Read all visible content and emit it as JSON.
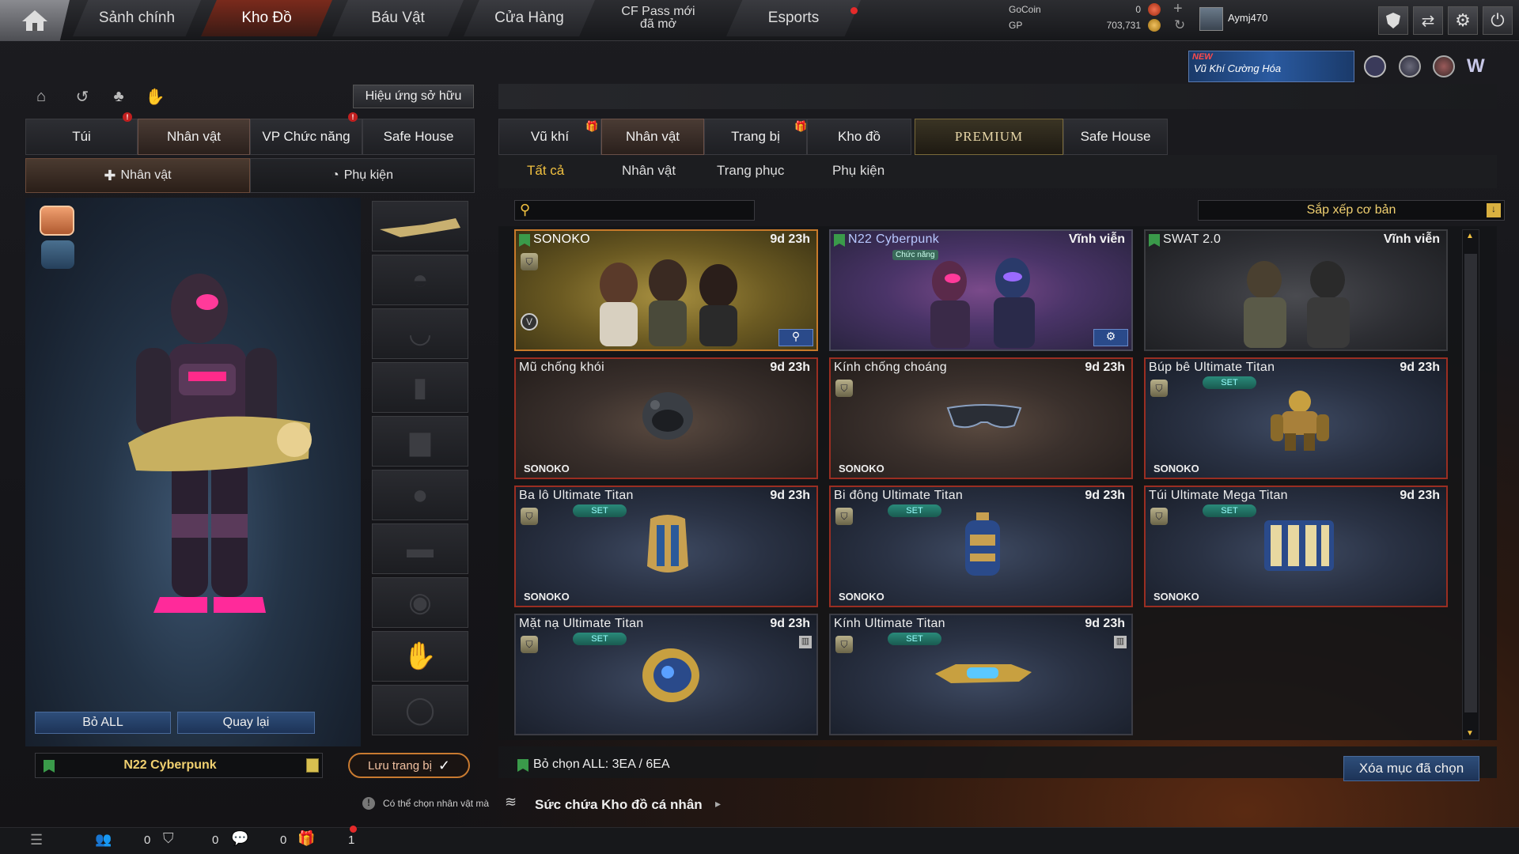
{
  "topbar": {
    "tabs": [
      "Sảnh chính",
      "Kho Đồ",
      "Báu Vật",
      "Cửa Hàng",
      "Esports"
    ],
    "pass_line1": "CF Pass mới",
    "pass_line2": "đã mở",
    "gocoin_label": "GoCoin",
    "gocoin_value": "0",
    "gp_label": "GP",
    "gp_value": "703,731",
    "username": "Aymj470",
    "banner_new": "NEW",
    "banner_text": "Vũ Khí Cường Hóa"
  },
  "left": {
    "owned_effects_btn": "Hiệu ứng sở hữu",
    "tabs": [
      "Túi",
      "Nhân vật",
      "VP Chức năng",
      "Safe House"
    ],
    "subtabs": [
      "Nhân vật",
      "Phụ kiện"
    ],
    "remove_all": "Bỏ ALL",
    "back": "Quay lại",
    "preset_name": "N22 Cyberpunk",
    "save_equip": "Lưu trang bị",
    "note": "Có thể chọn nhân vật mà"
  },
  "right": {
    "tabs": [
      "Vũ khí",
      "Nhân vật",
      "Trang bị",
      "Kho đồ",
      "PREMIUM",
      "Safe House"
    ],
    "filters": [
      "Tất cả",
      "Nhân vật",
      "Trang phục",
      "Phụ kiện"
    ],
    "search_placeholder": "",
    "sort_label": "Sắp xếp cơ bản",
    "items": [
      {
        "name": "SONOKO",
        "time": "9d 23h",
        "owner": "",
        "set": ""
      },
      {
        "name": "N22 Cyberpunk",
        "time": "Vĩnh viễn",
        "owner": "",
        "set": "",
        "tag": "Chức năng"
      },
      {
        "name": "SWAT 2.0",
        "time": "Vĩnh viễn",
        "owner": "",
        "set": ""
      },
      {
        "name": "Mũ chống khói",
        "time": "9d 23h",
        "owner": "SONOKO",
        "set": ""
      },
      {
        "name": "Kính chống choáng",
        "time": "9d 23h",
        "owner": "SONOKO",
        "set": ""
      },
      {
        "name": "Búp bê Ultimate Titan",
        "time": "9d 23h",
        "owner": "SONOKO",
        "set": "SET"
      },
      {
        "name": "Ba lô Ultimate Titan",
        "time": "9d 23h",
        "owner": "SONOKO",
        "set": "SET"
      },
      {
        "name": "Bi đông Ultimate Titan",
        "time": "9d 23h",
        "owner": "SONOKO",
        "set": "SET"
      },
      {
        "name": "Túi Ultimate Mega Titan",
        "time": "9d 23h",
        "owner": "SONOKO",
        "set": "SET"
      },
      {
        "name": "Mặt nạ Ultimate Titan",
        "time": "9d 23h",
        "owner": "",
        "set": "SET"
      },
      {
        "name": "Kính Ultimate Titan",
        "time": "9d 23h",
        "owner": "",
        "set": "SET"
      }
    ],
    "select_all": "Bỏ chọn ALL: 3EA / 6EA",
    "delete_selected": "Xóa mục đã chọn",
    "capacity": "Sức chứa Kho đồ cá nhân"
  },
  "footer": {
    "count1": "0",
    "count2": "0",
    "count3": "0",
    "count4": "1"
  }
}
